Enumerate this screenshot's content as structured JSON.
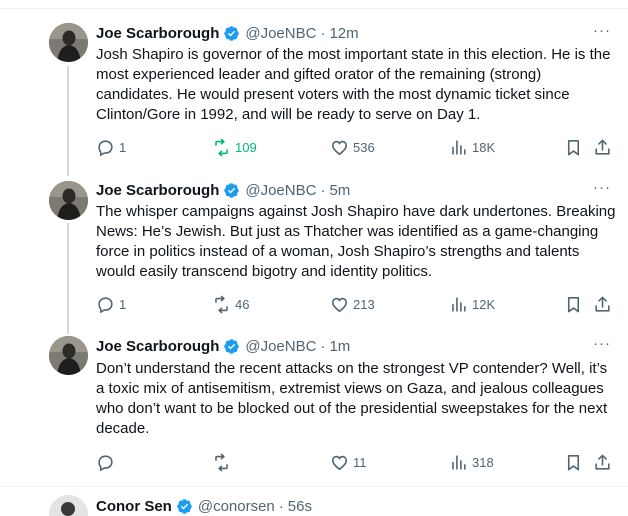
{
  "colors": {
    "verified": "#1d9bf0",
    "retweet_active": "#00ba7c",
    "muted": "#536471",
    "text": "#0f1419"
  },
  "tweets": [
    {
      "name": "Joe Scarborough",
      "handle": "@JoeNBC",
      "sep": "·",
      "time": "12m",
      "more": "···",
      "text": "Josh Shapiro is governor of the most important state in this election. He is the most experienced leader and gifted orator of the remaining (strong) candidates. He would present voters with the most dynamic ticket since Clinton/Gore in 1992, and will be ready to serve on Day 1.",
      "replies": "1",
      "retweets": "109",
      "likes": "536",
      "views": "18K"
    },
    {
      "name": "Joe Scarborough",
      "handle": "@JoeNBC",
      "sep": "·",
      "time": "5m",
      "more": "···",
      "text": "The whisper campaigns against Josh Shapiro have dark undertones. Breaking News: He’s Jewish. But just as Thatcher was identified as a game-changing force in politics instead of a woman, Josh Shapiro’s strengths and talents would easily transcend bigotry and identity politics.",
      "replies": "1",
      "retweets": "46",
      "likes": "213",
      "views": "12K"
    },
    {
      "name": "Joe Scarborough",
      "handle": "@JoeNBC",
      "sep": "·",
      "time": "1m",
      "more": "···",
      "text": "Don’t understand the recent attacks on the strongest VP contender? Well, it’s a toxic mix of antisemitism, extremist views on Gaza, and jealous colleagues who don’t want to be blocked out of the presidential sweepstakes for the next decade.",
      "replies": "",
      "retweets": "",
      "likes": "11",
      "views": "318"
    },
    {
      "name": "Conor Sen",
      "handle": "@conorsen",
      "sep": "·",
      "time": "56s"
    }
  ]
}
